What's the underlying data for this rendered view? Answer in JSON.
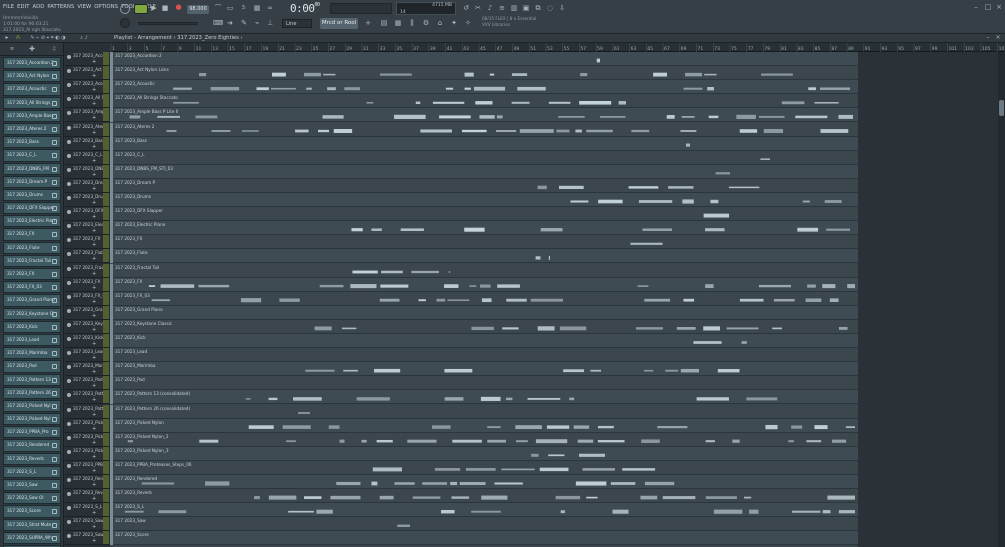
{
  "menu": [
    "FILE",
    "EDIT",
    "ADD",
    "PATTERNS",
    "VIEW",
    "OPTIONS",
    "TOOLS",
    "HELP"
  ],
  "hint": {
    "line1": "HmmmmVanilla",
    "line2": "1:01:00 for 90:03:21",
    "line3": "317 2023_Al ngh Staccato"
  },
  "tempo": "98.000",
  "timer": {
    "main": "0:00",
    "sub": "00"
  },
  "cpu": {
    "mem": "4715 MB",
    "voices": "14",
    "poly": "0"
  },
  "news": {
    "line1": "08/15  FLEX | 8 x Essential",
    "line2": "VVV Libraries"
  },
  "snap": "Line",
  "pattern_selector": "Mrcd or Rool",
  "breadcrumb": "Playlist - Arrangement › 317 2023_Zero Eighties ›",
  "ruler_marks": [
    "1",
    "3",
    "5",
    "7",
    "9",
    "11",
    "13",
    "15",
    "17",
    "19",
    "21",
    "23",
    "25",
    "27",
    "29",
    "31",
    "33",
    "35",
    "37",
    "39",
    "41",
    "43",
    "45",
    "47",
    "49",
    "51",
    "53",
    "55",
    "57",
    "59",
    "61",
    "63",
    "65",
    "67",
    "69",
    "71",
    "73",
    "75",
    "77",
    "79",
    "81",
    "83",
    "85",
    "87",
    "89",
    "91",
    "93",
    "95",
    "97",
    "99",
    "101",
    "103",
    "105",
    "107"
  ],
  "picker_items": [
    "317 2023_Accordion 2",
    "317 2023_Act Nylon",
    "317 2023_Acoustic",
    "317 2023_All Strings",
    "317 2023_Ample Bass",
    "317 2023_Ateres 2",
    "317 2023_Bass",
    "317 2023_C_L",
    "317 2023_DNBS_FM",
    "317 2023_Dream P",
    "317 2023_Drums",
    "317 2023_DFX Slapper",
    "317 2023_Electric Pian",
    "317 2023_FX",
    "317 2023_Flute",
    "317 2023_Fractal Tail",
    "317 2023_FX",
    "317 2023_FX_03",
    "317 2023_Grand Piano",
    "317 2023_Keystone Cl",
    "317 2023_Kick",
    "317 2023_Lead",
    "317 2023_Marimba",
    "317 2023_Pad",
    "317 2023_Pattern 13",
    "317 2023_Pattern 26",
    "317 2023_Picked Nyl",
    "317 2023_Picked Nyl",
    "317 2023_PPBA_Pro",
    "317 2023_Rendered",
    "317 2023_Reverb",
    "317 2023_S_L",
    "317 2023_Saw",
    "317 2023_Saw Ol",
    "317 2023_Score",
    "317 2023_Strat Mute",
    "317 2023_SUPRA_Wh",
    "317 2023_Transom",
    "317 2023_VHSonica"
  ],
  "tracks": [
    "317 2023_Accordion 2",
    "317 2023_Act Nylon Licks",
    "317 2023_Acoustic",
    "317 2023_All Strings Staccato",
    "317 2023_Ample Bass P Lite II",
    "317 2023_Ateres 2",
    "317 2023_Bass",
    "317 2023_C_L",
    "317 2023_DNBS_FM_STI_03",
    "317 2023_Dream P",
    "317 2023_Drums",
    "317 2023_DFX Slapper",
    "317 2023_Electric Piano",
    "317 2023_FX",
    "317 2023_Flute",
    "317 2023_Fractal Tail",
    "317 2023_FX",
    "317 2023_FX_03",
    "317 2023_Grand Piano",
    "317 2023_Keystone Classic",
    "317 2023_Kick",
    "317 2023_Lead",
    "317 2023_Marimba",
    "317 2023_Pad",
    "317 2023_Pattern 13 (consolidated)",
    "317 2023_Pattern 26 (consolidated)",
    "317 2023_Picked Nylon",
    "317 2023_Picked Nylon_2",
    "317 2023_Picked Nylon_3",
    "317 2023_PPBA_Proteases_Steps_06",
    "317 2023_Rendered",
    "317 2023_Reverb",
    "317 2023_S_L",
    "317 2023_Saw",
    "317 2023_Score"
  ],
  "track_headers": [
    "317 2023_Accor",
    "317 2023_Act N",
    "317 2023_Acou",
    "317 2023_All St",
    "317 2023_Ampl",
    "317 2023_Atere",
    "317 2023_Bass",
    "317 2023_C_L",
    "317 2023_DNBS",
    "317 2023_Drea",
    "317 2023_Drum",
    "317 2023_DFX S",
    "317 2023_Elect",
    "317 2023_FX",
    "317 2023_Flute",
    "317 2023_Fract",
    "317 2023_FX",
    "317 2023_FX_03",
    "317 2023_Gran",
    "317 2023_Keys",
    "317 2023_Kick",
    "317 2023_Lead",
    "317 2023_Mari",
    "317 2023_Pad",
    "317 2023_Patte",
    "317 2023_Patte",
    "317 2023_Pick",
    "317 2023_Pick",
    "317 2023_Pick",
    "317 2023_PPBA",
    "317 2023_Rend",
    "317 2023_Reve",
    "317 2023_S_L",
    "317 2023_Saw",
    "317 2023_Saw O"
  ],
  "colors": {
    "accent": "#8bc34a",
    "clip": "#c5d3da",
    "lane": "#3f4b52",
    "bg": "#2a3238"
  }
}
